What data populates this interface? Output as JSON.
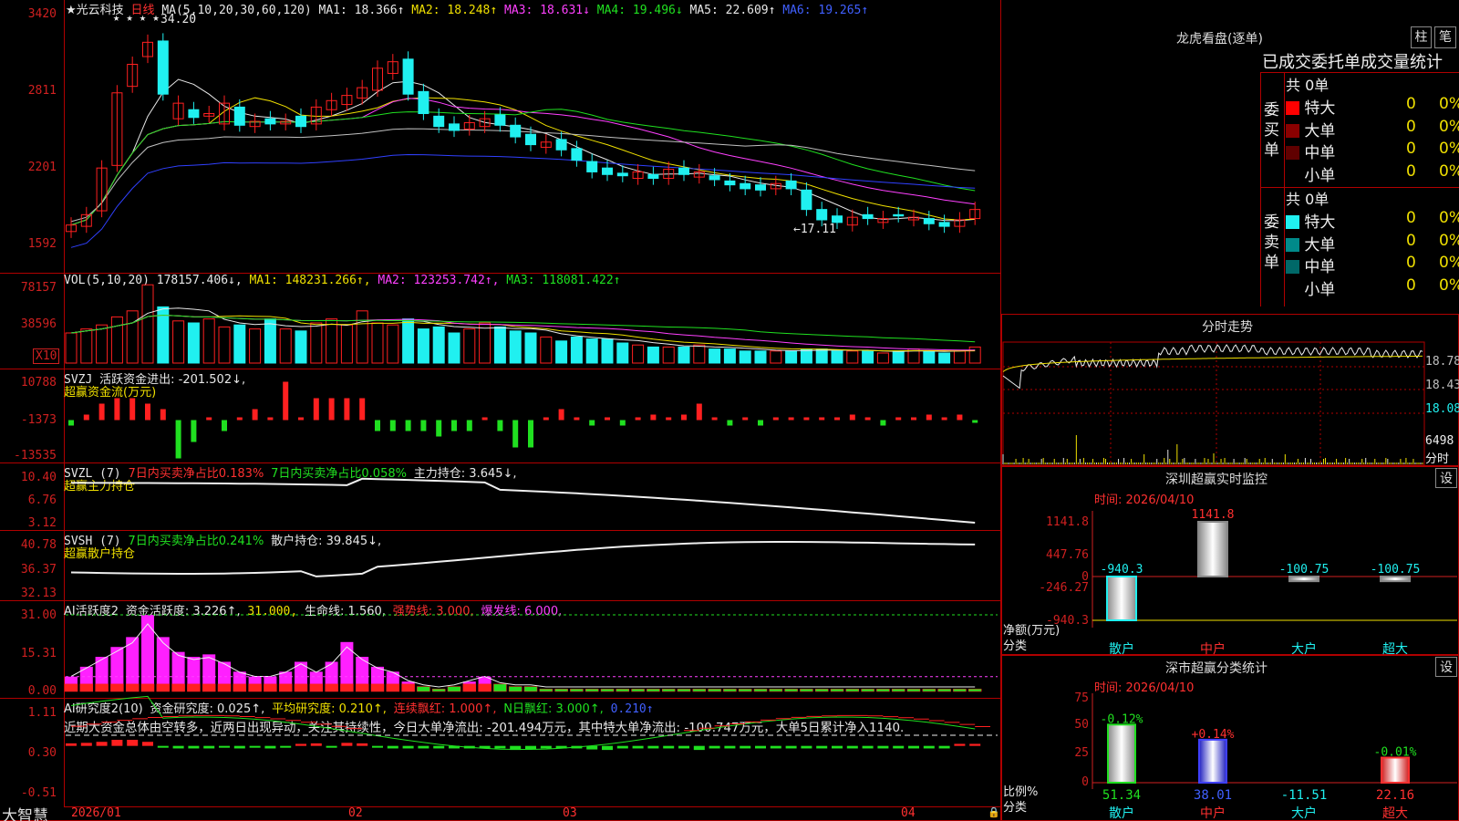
{
  "stock": {
    "name": "★光云科技",
    "period": "日线"
  },
  "ma_header": {
    "label": "MA(5,10,20,30,60,120)",
    "ma1": "MA1: 18.366↑",
    "ma2": "MA2: 18.248↑",
    "ma3": "MA3: 18.631↓",
    "ma4": "MA4: 19.496↓",
    "ma5": "MA5: 22.609↑",
    "ma6": "MA6: 19.265↑"
  },
  "price_axis": [
    "3420",
    "2811",
    "2201",
    "1592"
  ],
  "price_annot": {
    "high": "34.20",
    "low": "←17.11"
  },
  "vol_header": {
    "label": "VOL(5,10,20)",
    "val": "178157.406↓,",
    "ma1": "MA1: 148231.266↑,",
    "ma2": "MA2: 123253.742↑,",
    "ma3": "MA3: 118081.422↑"
  },
  "vol_axis": [
    "78157",
    "38596",
    "X10"
  ],
  "svzj": {
    "label": "SVZJ",
    "text": "活跃资金进出: -201.502↓,",
    "sub": "超赢资金流(万元)",
    "axis": [
      "10788",
      "-1373",
      "-13535"
    ]
  },
  "svzl": {
    "label": "SVZL (7)",
    "t1": "7日内买卖净占比0.183%",
    "t2": "7日内买卖净占比0.058%",
    "t3": "主力持仓: 3.645↓,",
    "sub": "超赢主力持仓",
    "axis": [
      "10.40",
      "6.76",
      "3.12"
    ]
  },
  "svsh": {
    "label": "SVSH (7)",
    "t1": "7日内买卖净占比0.241%",
    "t2": "散户持仓: 39.845↓,",
    "sub": "超赢散户持仓",
    "axis": [
      "40.78",
      "36.37",
      "32.13"
    ]
  },
  "ai_active": {
    "label": "AI活跃度2",
    "t1": "资金活跃度: 3.226↑,",
    "t2": "31.000,",
    "t3": "生命线: 1.560,",
    "t4": "强势线: 3.000,",
    "t5": "爆发线: 6.000,",
    "axis": [
      "31.00",
      "15.31",
      "0.00"
    ]
  },
  "ai_research": {
    "label": "AI研究度2(10)",
    "t1": "资金研究度: 0.025↑,",
    "t2": "平均研究度: 0.210↑,",
    "t3": "连续飘红: 1.000↑,",
    "t4": "N日飘红: 3.000↑,",
    "t5": "0.210↑",
    "comment": "近期大资金总体由空转多，近两日出现异动，关注其持续性，今日大单净流出: -201.494万元，其中特大单净流出: -100.747万元，大单5日累计净入1140.",
    "axis": [
      "1.11",
      "0.30",
      "-0.51"
    ]
  },
  "footer": {
    "logo": "大智慧",
    "dates": [
      "2026/01",
      "02",
      "03",
      "04"
    ]
  },
  "lhb": {
    "title": "龙虎看盘(逐单)",
    "btn_col": "柱",
    "btn_pen": "笔",
    "subtitle": "已成交委托单成交量统计",
    "buy": {
      "side": "委买单",
      "total": "共 0单",
      "rows": [
        {
          "label": "特大",
          "n": "0",
          "p": "0%",
          "color": "#ff0000"
        },
        {
          "label": "大单",
          "n": "0",
          "p": "0%",
          "color": "#8a0000"
        },
        {
          "label": "中单",
          "n": "0",
          "p": "0%",
          "color": "#600000"
        },
        {
          "label": "小单",
          "n": "0",
          "p": "0%",
          "color": ""
        }
      ]
    },
    "sell": {
      "side": "委卖单",
      "total": "共 0单",
      "rows": [
        {
          "label": "特大",
          "n": "0",
          "p": "0%",
          "color": "#20f0f0"
        },
        {
          "label": "大单",
          "n": "0",
          "p": "0%",
          "color": "#008a8a"
        },
        {
          "label": "中单",
          "n": "0",
          "p": "0%",
          "color": "#006868"
        },
        {
          "label": "小单",
          "n": "0",
          "p": "0%",
          "color": ""
        }
      ]
    }
  },
  "intraday": {
    "title": "分时走势",
    "axis": [
      "18.78",
      "18.43",
      "18.08",
      "6498",
      "分时"
    ]
  },
  "sz_monitor": {
    "title": "深圳超赢实时监控",
    "btn": "设",
    "time": "时间: 2026/04/10",
    "axis": [
      "1141.8",
      "447.76",
      "0",
      "-246.27",
      "-940.3"
    ],
    "ylabel": "净额(万元)",
    "xlabel": "分类",
    "bars": [
      {
        "cat": "散户",
        "value": -940.3,
        "label": "-940.3"
      },
      {
        "cat": "中户",
        "value": 1141.8,
        "label": "1141.8"
      },
      {
        "cat": "大户",
        "value": -100.75,
        "label": "-100.75"
      },
      {
        "cat": "超大",
        "value": -100.75,
        "label": "-100.75"
      }
    ]
  },
  "sz_class": {
    "title": "深市超赢分类统计",
    "btn": "设",
    "time": "时间: 2026/04/10",
    "axis": [
      "75",
      "50",
      "25",
      "0"
    ],
    "ylabel": "比例%",
    "xlabel": "分类",
    "bars": [
      {
        "cat": "散户",
        "value": 51.34,
        "label": "51.34",
        "top": "-0.12%"
      },
      {
        "cat": "中户",
        "value": 38.01,
        "label": "38.01",
        "top": "+0.14%"
      },
      {
        "cat": "大户",
        "value": -11.51,
        "label": "-11.51",
        "top": ""
      },
      {
        "cat": "超大",
        "value": 22.16,
        "label": "22.16",
        "top": "-0.01%"
      }
    ]
  },
  "colors": {
    "up": "#ff2020",
    "down": "#20f0f0",
    "frame": "#b00000"
  }
}
